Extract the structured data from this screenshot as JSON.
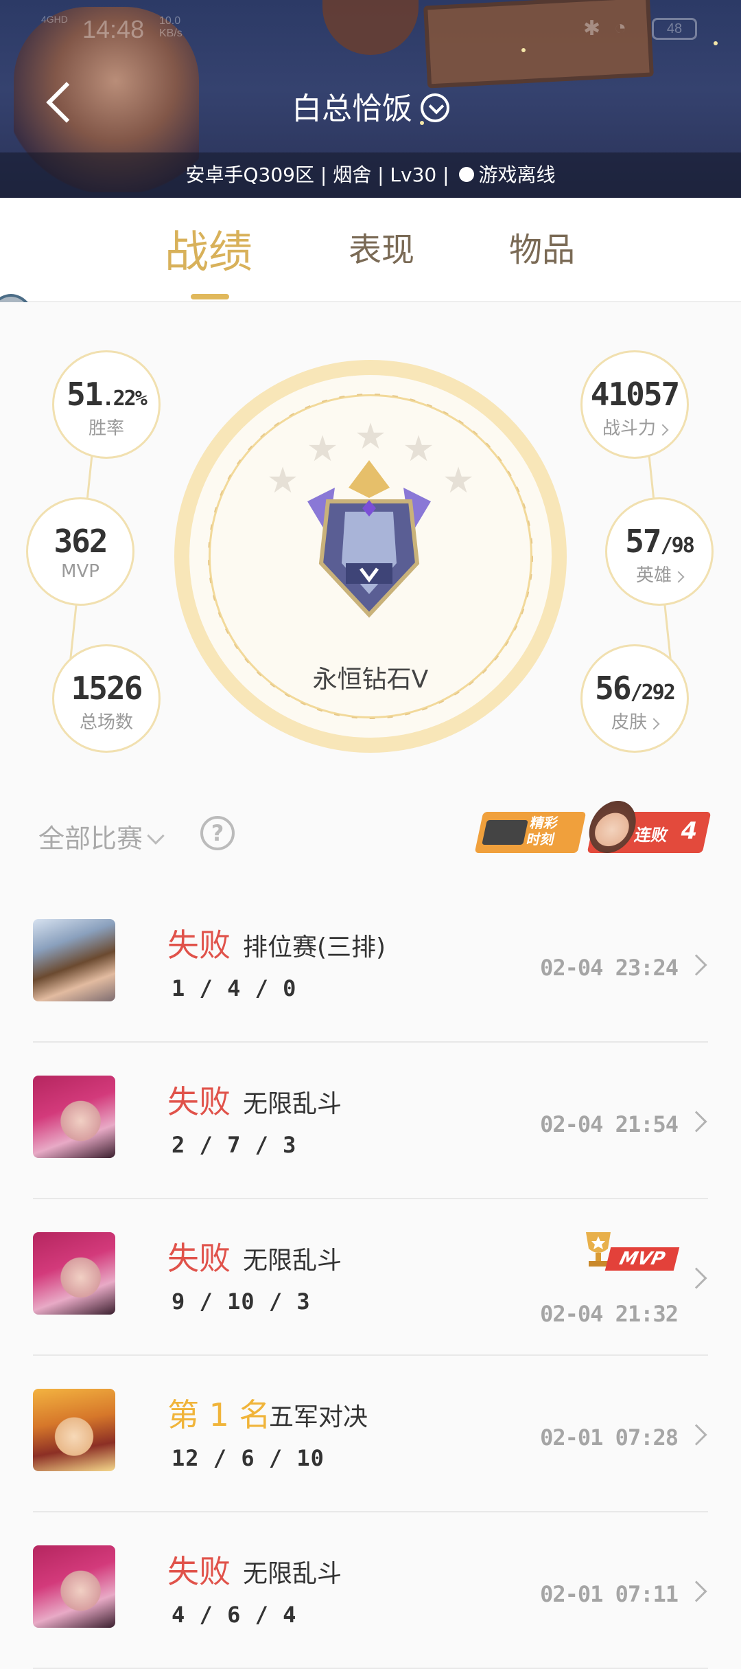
{
  "status": {
    "network": "4GHD",
    "time": "14:48",
    "speed_value": "10.0",
    "speed_unit": "KB/s",
    "battery": "48"
  },
  "header": {
    "title": "白总恰饭",
    "subtitle_prefix": "安卓手Q309区 | 烟舍 | Lv30 |",
    "online_status": "游戏离线"
  },
  "tabs": [
    {
      "label": "战绩",
      "active": true
    },
    {
      "label": "表现",
      "active": false
    },
    {
      "label": "物品",
      "active": false
    }
  ],
  "stats": {
    "win_rate_int": "51",
    "win_rate_dec": ".22%",
    "win_rate_label": "胜率",
    "mvp_value": "362",
    "mvp_label": "MVP",
    "total_value": "1526",
    "total_label": "总场数",
    "power_value": "41057",
    "power_label": "战斗力",
    "heroes_owned": "57",
    "heroes_total": "/98",
    "heroes_label": "英雄",
    "skins_owned": "56",
    "skins_total": "/292",
    "skins_label": "皮肤"
  },
  "rank": {
    "name": "永恒钻石V",
    "stars": 5
  },
  "filter": {
    "all_label": "全部比赛",
    "help_glyph": "?",
    "highlight_badge": [
      "精彩",
      "时刻"
    ],
    "streak_label": "连败",
    "streak_count": "4"
  },
  "matches": [
    {
      "result": "失败",
      "result_type": "lose",
      "mode": "排位赛(三排)",
      "kda": "1 / 4 / 0",
      "time": "02-04 23:24",
      "mvp": false,
      "hero": "hero-a"
    },
    {
      "result": "失败",
      "result_type": "lose",
      "mode": "无限乱斗",
      "kda": "2 / 7 / 3",
      "time": "02-04 21:54",
      "mvp": false,
      "hero": "hero-b"
    },
    {
      "result": "失败",
      "result_type": "lose",
      "mode": "无限乱斗",
      "kda": "9 / 10 / 3",
      "time": "02-04 21:32",
      "mvp": true,
      "mvp_label": "MVP",
      "hero": "hero-b"
    },
    {
      "result": "第 1 名",
      "result_type": "win",
      "mode": "五军对决",
      "kda": "12 / 6 / 10",
      "time": "02-01 07:28",
      "mvp": false,
      "hero": "hero-c"
    },
    {
      "result": "失败",
      "result_type": "lose",
      "mode": "无限乱斗",
      "kda": "4 / 6 / 4",
      "time": "02-01 07:11",
      "mvp": false,
      "hero": "hero-b"
    }
  ],
  "colors": {
    "accent_gold": "#d8b15a",
    "lose_red": "#e0524a",
    "win_gold": "#f0b43a"
  }
}
